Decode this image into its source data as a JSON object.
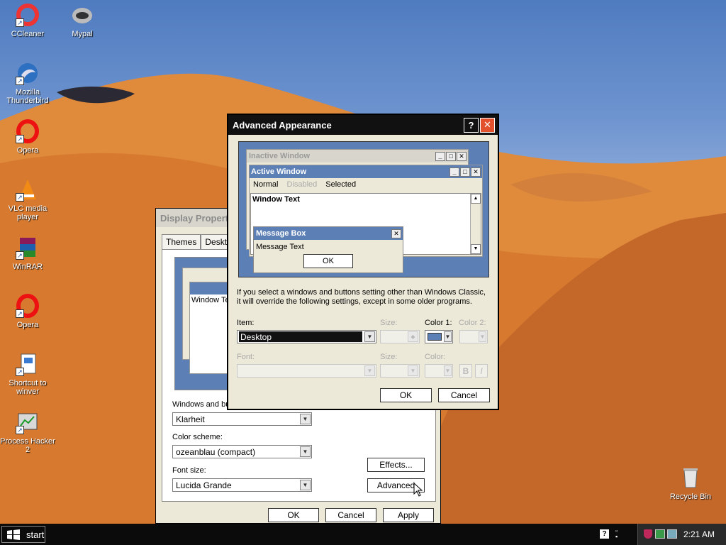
{
  "desktop": {
    "icons": [
      {
        "label": "CCleaner"
      },
      {
        "label": "Mypal"
      },
      {
        "label": "Mozilla Thunderbird"
      },
      {
        "label": "Opera"
      },
      {
        "label": "VLC media player"
      },
      {
        "label": "WinRAR"
      },
      {
        "label": "Opera"
      },
      {
        "label": "Shortcut to winver"
      },
      {
        "label": "Process Hacker 2"
      },
      {
        "label": "Recycle Bin"
      }
    ]
  },
  "display_properties": {
    "title": "Display Propert",
    "tabs": [
      "Themes",
      "Deskto"
    ],
    "preview_text": "Window Te",
    "windows_buttons_label": "Windows and bu",
    "windows_buttons_value": "Klarheit",
    "color_scheme_label": "Color scheme:",
    "color_scheme_value": "ozeanblau (compact)",
    "font_size_label": "Font size:",
    "font_size_value": "Lucida Grande",
    "effects_button": "Effects...",
    "advanced_button": "Advanced",
    "ok_button": "OK",
    "cancel_button": "Cancel",
    "apply_button": "Apply"
  },
  "advanced_appearance": {
    "title": "Advanced Appearance",
    "help_glyph": "?",
    "close_glyph": "✕",
    "preview": {
      "inactive_title": "Inactive Window",
      "active_title": "Active Window",
      "menu_normal": "Normal",
      "menu_disabled": "Disabled",
      "menu_selected": "Selected",
      "window_text": "Window Text",
      "msgbox_title": "Message Box",
      "msgbox_text": "Message Text",
      "msgbox_ok": "OK"
    },
    "info_text_line1": "If you select a windows and buttons setting other than Windows Classic,",
    "info_text_line2": "it will override the following settings, except in some older programs.",
    "item_label": "Item:",
    "item_value": "Desktop",
    "size_label": "Size:",
    "color1_label": "Color 1:",
    "color2_label": "Color 2:",
    "font_label": "Font:",
    "font_size_label": "Size:",
    "font_color_label": "Color:",
    "bold_glyph": "B",
    "italic_glyph": "I",
    "ok_button": "OK",
    "cancel_button": "Cancel",
    "color1_value": "#5c7fb6"
  },
  "taskbar": {
    "start_label": "start",
    "clock": "2:21 AM"
  }
}
